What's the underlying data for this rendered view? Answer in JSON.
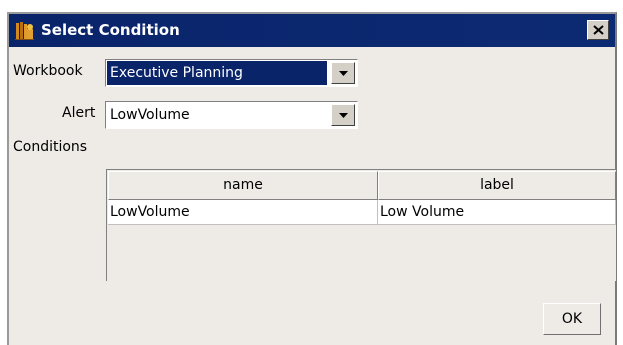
{
  "window": {
    "title": "Select Condition",
    "title_bar_color": "#0a246a",
    "selection_color": "#0a246a"
  },
  "form": {
    "workbook_label": "Workbook",
    "workbook_value": "Executive Planning",
    "alert_label": "Alert",
    "alert_value": "LowVolume",
    "conditions_label": "Conditions"
  },
  "table": {
    "columns": [
      "name",
      "label"
    ],
    "rows": [
      [
        "LowVolume",
        "Low Volume"
      ]
    ]
  },
  "buttons": {
    "ok_label": "OK"
  },
  "icons": {
    "title_icon": "books-icon",
    "close_icon": "close-icon",
    "dropdown_icon": "chevron-down-icon"
  }
}
